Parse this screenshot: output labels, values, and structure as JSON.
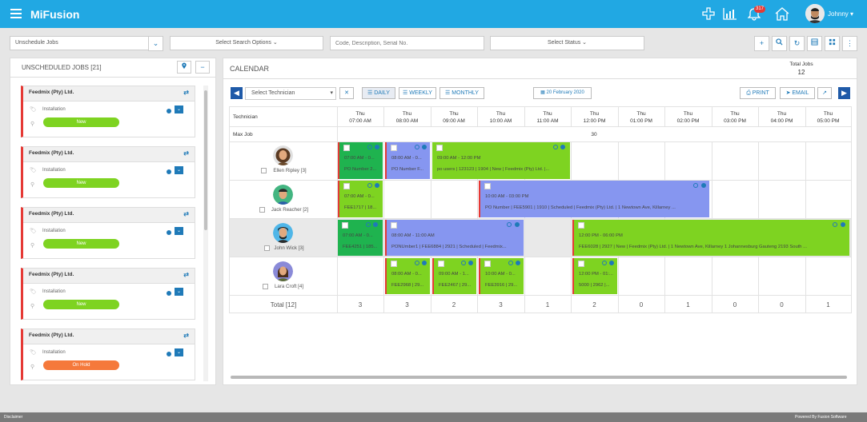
{
  "app": {
    "title": "MiFusion",
    "user": "Johnny",
    "notif_count": "317"
  },
  "icons": {
    "menu": "hamburger-icon",
    "add": "plus-icon",
    "chart": "bar-chart-icon",
    "bell": "bell-icon",
    "home": "home-icon",
    "map": "map-pin-icon",
    "search": "search-icon",
    "refresh": "refresh-icon",
    "grid": "grid-icon",
    "calendar": "calendar-icon",
    "print": "print-icon",
    "email": "email-icon"
  },
  "colors": {
    "header": "#21a8e3",
    "green_dark": "#1fb34f",
    "green": "#7ed321",
    "blue": "#8696f0",
    "red": "#e53935",
    "orange": "#f5793b"
  },
  "toolbar": {
    "dropdown": "Unschedule Jobs",
    "search_options": "Select Search Options ⌄",
    "search_placeholder": "Code, Description, Serial No.",
    "status": "Select Status ⌄",
    "more": "⋮"
  },
  "left": {
    "title": "UNSCHEDULED JOBS [21]",
    "cards": [
      {
        "company": "Feedmix (Pty) Ltd.",
        "type": "Installation",
        "status": "New"
      },
      {
        "company": "Feedmix (Pty) Ltd.",
        "type": "Installation",
        "status": "New"
      },
      {
        "company": "Feedmix (Pty) Ltd.",
        "type": "Installation",
        "status": "New"
      },
      {
        "company": "Feedmix (Pty) Ltd.",
        "type": "Installation",
        "status": "New"
      },
      {
        "company": "Feedmix (Pty) Ltd.",
        "type": "Installation",
        "status": "On Hold"
      }
    ]
  },
  "calendar": {
    "title": "CALENDAR",
    "total_label": "Total Jobs",
    "total_value": "12",
    "technician_select": "Select Technician",
    "daily": "DAILY",
    "weekly": "WEEKLY",
    "monthly": "MONTHLY",
    "date": "20 February 2020",
    "print": "PRINT",
    "email": "EMAIL",
    "col_header": "Technician",
    "max_job_label": "Max Job",
    "max_job_value": "30",
    "days": [
      "Thu",
      "Thu",
      "Thu",
      "Thu",
      "Thu",
      "Thu",
      "Thu",
      "Thu",
      "Thu",
      "Thu",
      "Thu"
    ],
    "times": [
      "07:00 AM",
      "08:00 AM",
      "09:00 AM",
      "10:00 AM",
      "11:00 AM",
      "12:00 PM",
      "01:00 PM",
      "02:00 PM",
      "03:00 PM",
      "04:00 PM",
      "05:00 PM"
    ],
    "technicians": [
      "Ellen Ripley [3]",
      "Jack Reacher [2]",
      "John Wick [3]",
      "Lara Croft [4]"
    ],
    "jobs": [
      {
        "time": "07:00 AM - 0...",
        "body": "PO Number 2..."
      },
      {
        "time": "08:00 AM - 0...",
        "body": "PO Number F..."
      },
      {
        "time": "09:00 AM - 12:00 PM",
        "body": "po users | 123123 | 1904 | New | Feedmix (Pty) Ltd. |..."
      },
      {
        "time": "07:00 AM - 0...",
        "body": "FEE1717 | 18..."
      },
      {
        "time": "10:00 AM - 03:00 PM",
        "body": "PO Number | FEE5901 | 1910 | Scheduled | Feedmix (Pty) Ltd. | 1 Newtown Ave, Killarney ..."
      },
      {
        "time": "07:00 AM - 0...",
        "body": "FEE4251 | 185..."
      },
      {
        "time": "08:00 AM - 11:00 AM",
        "body": "PONUmber1 | FEE6884 | 2921 | Scheduled | Feedmix..."
      },
      {
        "time": "12:00 PM - 06:00 PM",
        "body": "FEE6028 | 2927 | New | Feedmix (Pty) Ltd. | 1 Newtown Ave, Killarney 1 Johannesburg Gauteng 2193 South ..."
      },
      {
        "time": "08:00 AM - 0...",
        "body": "FEE2968 | 29..."
      },
      {
        "time": "09:00 AM - 1...",
        "body": "FEE2467 | 29..."
      },
      {
        "time": "10:00 AM - 0...",
        "body": "FEE3916 | 29..."
      },
      {
        "time": "12:00 PM - 01:...",
        "body": "5000 | 2962 |..."
      }
    ],
    "total_label_row": "Total [12]",
    "totals": [
      "3",
      "3",
      "2",
      "3",
      "1",
      "2",
      "0",
      "1",
      "0",
      "0",
      "1"
    ]
  },
  "footer": {
    "left": "Disclaimer",
    "right": "Powered By Fusion Software"
  }
}
